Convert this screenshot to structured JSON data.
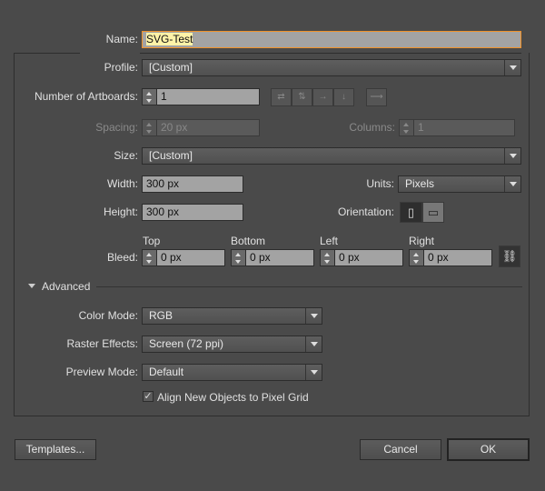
{
  "name": {
    "label": "Name:",
    "value": "SVG-Test"
  },
  "profile": {
    "label": "Profile:",
    "value": "[Custom]"
  },
  "artboards": {
    "label": "Number of Artboards:",
    "value": "1"
  },
  "spacing": {
    "label": "Spacing:",
    "value": "20 px"
  },
  "columns": {
    "label": "Columns:",
    "value": "1"
  },
  "size": {
    "label": "Size:",
    "value": "[Custom]"
  },
  "width": {
    "label": "Width:",
    "value": "300 px"
  },
  "units": {
    "label": "Units:",
    "value": "Pixels"
  },
  "height": {
    "label": "Height:",
    "value": "300 px"
  },
  "orientation": {
    "label": "Orientation:",
    "selected": "portrait"
  },
  "bleed": {
    "label": "Bleed:",
    "top_label": "Top",
    "top": "0 px",
    "bottom_label": "Bottom",
    "bottom": "0 px",
    "left_label": "Left",
    "left": "0 px",
    "right_label": "Right",
    "right": "0 px"
  },
  "advanced": {
    "label": "Advanced",
    "expanded": true,
    "color_mode": {
      "label": "Color Mode:",
      "value": "RGB"
    },
    "raster": {
      "label": "Raster Effects:",
      "value": "Screen (72 ppi)"
    },
    "preview": {
      "label": "Preview Mode:",
      "value": "Default"
    },
    "align": {
      "label": "Align New Objects to Pixel Grid",
      "checked": true
    }
  },
  "buttons": {
    "templates": "Templates...",
    "cancel": "Cancel",
    "ok": "OK"
  },
  "colors": {
    "focus": "#f0922a",
    "highlight": "#fff3a8"
  }
}
